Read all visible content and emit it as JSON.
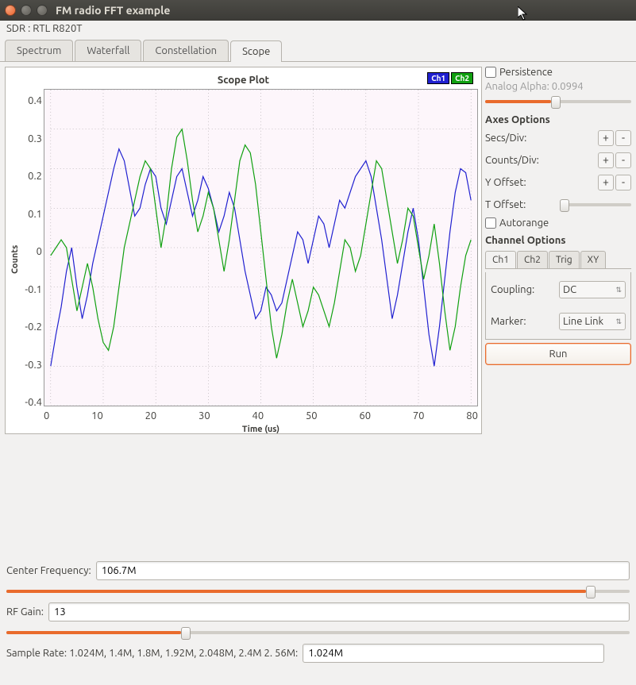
{
  "window": {
    "title": "FM radio FFT example"
  },
  "menubar": "SDR : RTL R820T",
  "tabs": [
    "Spectrum",
    "Waterfall",
    "Constellation",
    "Scope"
  ],
  "active_tab": 3,
  "plot": {
    "title": "Scope Plot",
    "xlabel": "Time (us)",
    "ylabel": "Counts",
    "legend": [
      "Ch1",
      "Ch2"
    ]
  },
  "side": {
    "persistence": {
      "label": "Persistence",
      "checked": false
    },
    "alpha_label": "Analog Alpha: 0.0994",
    "axes_title": "Axes Options",
    "secs_div": "Secs/Div:",
    "counts_div": "Counts/Div:",
    "y_offset": "Y Offset:",
    "t_offset": "T Offset:",
    "autorange": {
      "label": "Autorange",
      "checked": false
    },
    "channel_title": "Channel Options",
    "subtabs": [
      "Ch1",
      "Ch2",
      "Trig",
      "XY"
    ],
    "coupling_label": "Coupling:",
    "coupling_value": "DC",
    "marker_label": "Marker:",
    "marker_value": "Line Link",
    "run_label": "Run"
  },
  "bottom": {
    "cf_label": "Center Frequency:",
    "cf_value": "106.7M",
    "cf_pct": 93,
    "gain_label": "RF Gain:",
    "gain_value": "13",
    "gain_pct": 28,
    "sr_label": "Sample Rate: 1.024M, 1.4M, 1.8M, 1.92M, 2.048M, 2.4M  2. 56M:",
    "sr_value": "1.024M"
  },
  "chart_data": {
    "type": "line",
    "title": "Scope Plot",
    "xlabel": "Time (us)",
    "ylabel": "Counts",
    "xlim": [
      0,
      80
    ],
    "ylim": [
      -0.4,
      0.4
    ],
    "xticks": [
      0,
      10,
      20,
      30,
      40,
      50,
      60,
      70,
      80
    ],
    "yticks": [
      -0.4,
      -0.3,
      -0.2,
      -0.1,
      0,
      0.1,
      0.2,
      0.3,
      0.4
    ],
    "series": [
      {
        "name": "Ch1",
        "color": "#2020d0",
        "x": [
          0,
          1,
          2,
          3,
          4,
          5,
          6,
          7,
          8,
          9,
          10,
          11,
          12,
          13,
          14,
          15,
          16,
          17,
          18,
          19,
          20,
          21,
          22,
          23,
          24,
          25,
          26,
          27,
          28,
          29,
          30,
          31,
          32,
          33,
          34,
          35,
          36,
          37,
          38,
          39,
          40,
          41,
          42,
          43,
          44,
          45,
          46,
          47,
          48,
          49,
          50,
          51,
          52,
          53,
          54,
          55,
          56,
          57,
          58,
          59,
          60,
          61,
          62,
          63,
          64,
          65,
          66,
          67,
          68,
          69,
          70,
          71,
          72,
          73,
          74,
          75,
          76,
          77,
          78,
          79,
          80
        ],
        "y": [
          -0.3,
          -0.22,
          -0.15,
          -0.06,
          0.0,
          -0.1,
          -0.18,
          -0.12,
          -0.04,
          0.02,
          0.08,
          0.14,
          0.2,
          0.25,
          0.22,
          0.15,
          0.08,
          0.1,
          0.16,
          0.2,
          0.18,
          0.1,
          0.06,
          0.12,
          0.18,
          0.2,
          0.14,
          0.08,
          0.12,
          0.18,
          0.15,
          0.1,
          0.04,
          0.08,
          0.14,
          0.1,
          0.02,
          -0.06,
          -0.12,
          -0.18,
          -0.16,
          -0.1,
          -0.12,
          -0.16,
          -0.14,
          -0.08,
          -0.02,
          0.04,
          0.02,
          -0.04,
          0.02,
          0.08,
          0.06,
          0.0,
          0.06,
          0.12,
          0.1,
          0.14,
          0.18,
          0.2,
          0.22,
          0.18,
          0.1,
          0.02,
          -0.08,
          -0.18,
          -0.12,
          -0.04,
          0.04,
          0.1,
          0.02,
          -0.1,
          -0.22,
          -0.3,
          -0.2,
          -0.08,
          0.04,
          0.14,
          0.2,
          0.19,
          0.12
        ]
      },
      {
        "name": "Ch2",
        "color": "#10a010",
        "x": [
          0,
          1,
          2,
          3,
          4,
          5,
          6,
          7,
          8,
          9,
          10,
          11,
          12,
          13,
          14,
          15,
          16,
          17,
          18,
          19,
          20,
          21,
          22,
          23,
          24,
          25,
          26,
          27,
          28,
          29,
          30,
          31,
          32,
          33,
          34,
          35,
          36,
          37,
          38,
          39,
          40,
          41,
          42,
          43,
          44,
          45,
          46,
          47,
          48,
          49,
          50,
          51,
          52,
          53,
          54,
          55,
          56,
          57,
          58,
          59,
          60,
          61,
          62,
          63,
          64,
          65,
          66,
          67,
          68,
          69,
          70,
          71,
          72,
          73,
          74,
          75,
          76,
          77,
          78,
          79,
          80
        ],
        "y": [
          -0.02,
          0.0,
          0.02,
          0.0,
          -0.08,
          -0.16,
          -0.1,
          -0.04,
          -0.1,
          -0.18,
          -0.24,
          -0.26,
          -0.2,
          -0.1,
          0.0,
          0.06,
          0.12,
          0.18,
          0.22,
          0.2,
          0.1,
          0.0,
          0.08,
          0.2,
          0.28,
          0.3,
          0.22,
          0.12,
          0.04,
          0.08,
          0.14,
          0.1,
          0.02,
          -0.06,
          0.02,
          0.12,
          0.22,
          0.26,
          0.24,
          0.16,
          0.04,
          -0.08,
          -0.2,
          -0.28,
          -0.22,
          -0.14,
          -0.08,
          -0.14,
          -0.2,
          -0.16,
          -0.1,
          -0.12,
          -0.16,
          -0.2,
          -0.14,
          -0.06,
          0.02,
          0.0,
          -0.06,
          -0.02,
          0.06,
          0.14,
          0.22,
          0.2,
          0.12,
          0.04,
          -0.04,
          0.02,
          0.1,
          0.08,
          0.0,
          -0.08,
          -0.02,
          0.06,
          -0.04,
          -0.16,
          -0.26,
          -0.2,
          -0.1,
          -0.02,
          0.02
        ]
      }
    ]
  }
}
